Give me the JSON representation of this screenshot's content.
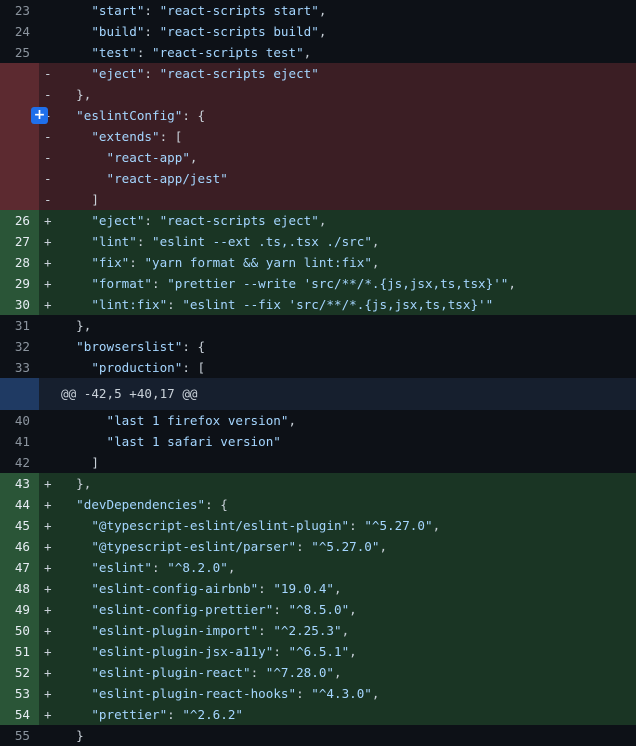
{
  "diff": {
    "lines": [
      {
        "type": "context",
        "num": "23",
        "sign": "",
        "segs": [
          [
            "p",
            "    "
          ],
          [
            "k",
            "\"start\""
          ],
          [
            "p",
            ": "
          ],
          [
            "k",
            "\"react-scripts start\""
          ],
          [
            "p",
            ","
          ]
        ]
      },
      {
        "type": "context",
        "num": "24",
        "sign": "",
        "segs": [
          [
            "p",
            "    "
          ],
          [
            "k",
            "\"build\""
          ],
          [
            "p",
            ": "
          ],
          [
            "k",
            "\"react-scripts build\""
          ],
          [
            "p",
            ","
          ]
        ]
      },
      {
        "type": "context",
        "num": "25",
        "sign": "",
        "segs": [
          [
            "p",
            "    "
          ],
          [
            "k",
            "\"test\""
          ],
          [
            "p",
            ": "
          ],
          [
            "k",
            "\"react-scripts test\""
          ],
          [
            "p",
            ","
          ]
        ]
      },
      {
        "type": "del",
        "num": "",
        "sign": "-",
        "segs": [
          [
            "p",
            "    "
          ],
          [
            "k",
            "\"eject\""
          ],
          [
            "p",
            ": "
          ],
          [
            "k",
            "\"react-scripts eject\""
          ]
        ]
      },
      {
        "type": "del",
        "num": "",
        "sign": "-",
        "segs": [
          [
            "p",
            "  },"
          ]
        ]
      },
      {
        "type": "del",
        "num": "",
        "sign": "-",
        "expand": true,
        "segs": [
          [
            "p",
            "  "
          ],
          [
            "k",
            "\"eslintConfig\""
          ],
          [
            "p",
            ": {"
          ]
        ]
      },
      {
        "type": "del",
        "num": "",
        "sign": "-",
        "segs": [
          [
            "p",
            "    "
          ],
          [
            "k",
            "\"extends\""
          ],
          [
            "p",
            ": ["
          ]
        ]
      },
      {
        "type": "del",
        "num": "",
        "sign": "-",
        "segs": [
          [
            "p",
            "      "
          ],
          [
            "k",
            "\"react-app\""
          ],
          [
            "p",
            ","
          ]
        ]
      },
      {
        "type": "del",
        "num": "",
        "sign": "-",
        "segs": [
          [
            "p",
            "      "
          ],
          [
            "k",
            "\"react-app/jest\""
          ]
        ]
      },
      {
        "type": "del",
        "num": "",
        "sign": "-",
        "segs": [
          [
            "p",
            "    ]"
          ]
        ]
      },
      {
        "type": "add",
        "num": "26",
        "sign": "+",
        "segs": [
          [
            "p",
            "    "
          ],
          [
            "k",
            "\"eject\""
          ],
          [
            "p",
            ": "
          ],
          [
            "k",
            "\"react-scripts eject\""
          ],
          [
            "p",
            ","
          ]
        ]
      },
      {
        "type": "add",
        "num": "27",
        "sign": "+",
        "segs": [
          [
            "p",
            "    "
          ],
          [
            "k",
            "\"lint\""
          ],
          [
            "p",
            ": "
          ],
          [
            "k",
            "\"eslint --ext .ts,.tsx ./src\""
          ],
          [
            "p",
            ","
          ]
        ]
      },
      {
        "type": "add",
        "num": "28",
        "sign": "+",
        "segs": [
          [
            "p",
            "    "
          ],
          [
            "k",
            "\"fix\""
          ],
          [
            "p",
            ": "
          ],
          [
            "k",
            "\"yarn format && yarn lint:fix\""
          ],
          [
            "p",
            ","
          ]
        ]
      },
      {
        "type": "add",
        "num": "29",
        "sign": "+",
        "segs": [
          [
            "p",
            "    "
          ],
          [
            "k",
            "\"format\""
          ],
          [
            "p",
            ": "
          ],
          [
            "k",
            "\"prettier --write 'src/**/*.{js,jsx,ts,tsx}'\""
          ],
          [
            "p",
            ","
          ]
        ]
      },
      {
        "type": "add",
        "num": "30",
        "sign": "+",
        "segs": [
          [
            "p",
            "    "
          ],
          [
            "k",
            "\"lint:fix\""
          ],
          [
            "p",
            ": "
          ],
          [
            "k",
            "\"eslint --fix 'src/**/*.{js,jsx,ts,tsx}'\""
          ]
        ]
      },
      {
        "type": "context",
        "num": "31",
        "sign": "",
        "segs": [
          [
            "p",
            "  },"
          ]
        ]
      },
      {
        "type": "context",
        "num": "32",
        "sign": "",
        "segs": [
          [
            "p",
            "  "
          ],
          [
            "k",
            "\"browserslist\""
          ],
          [
            "p",
            ": {"
          ]
        ]
      },
      {
        "type": "context",
        "num": "33",
        "sign": "",
        "segs": [
          [
            "p",
            "    "
          ],
          [
            "k",
            "\"production\""
          ],
          [
            "p",
            ": ["
          ]
        ]
      },
      {
        "type": "hunk",
        "num": "",
        "sign": "",
        "segs": [
          [
            "p",
            "@@ -42,5 +40,17 @@"
          ]
        ]
      },
      {
        "type": "context",
        "num": "40",
        "sign": "",
        "segs": [
          [
            "p",
            "      "
          ],
          [
            "k",
            "\"last 1 firefox version\""
          ],
          [
            "p",
            ","
          ]
        ]
      },
      {
        "type": "context",
        "num": "41",
        "sign": "",
        "segs": [
          [
            "p",
            "      "
          ],
          [
            "k",
            "\"last 1 safari version\""
          ]
        ]
      },
      {
        "type": "context",
        "num": "42",
        "sign": "",
        "segs": [
          [
            "p",
            "    ]"
          ]
        ]
      },
      {
        "type": "add",
        "num": "43",
        "sign": "+",
        "segs": [
          [
            "p",
            "  },"
          ]
        ]
      },
      {
        "type": "add",
        "num": "44",
        "sign": "+",
        "segs": [
          [
            "p",
            "  "
          ],
          [
            "k",
            "\"devDependencies\""
          ],
          [
            "p",
            ": {"
          ]
        ]
      },
      {
        "type": "add",
        "num": "45",
        "sign": "+",
        "segs": [
          [
            "p",
            "    "
          ],
          [
            "k",
            "\"@typescript-eslint/eslint-plugin\""
          ],
          [
            "p",
            ": "
          ],
          [
            "k",
            "\"^5.27.0\""
          ],
          [
            "p",
            ","
          ]
        ]
      },
      {
        "type": "add",
        "num": "46",
        "sign": "+",
        "segs": [
          [
            "p",
            "    "
          ],
          [
            "k",
            "\"@typescript-eslint/parser\""
          ],
          [
            "p",
            ": "
          ],
          [
            "k",
            "\"^5.27.0\""
          ],
          [
            "p",
            ","
          ]
        ]
      },
      {
        "type": "add",
        "num": "47",
        "sign": "+",
        "segs": [
          [
            "p",
            "    "
          ],
          [
            "k",
            "\"eslint\""
          ],
          [
            "p",
            ": "
          ],
          [
            "k",
            "\"^8.2.0\""
          ],
          [
            "p",
            ","
          ]
        ]
      },
      {
        "type": "add",
        "num": "48",
        "sign": "+",
        "segs": [
          [
            "p",
            "    "
          ],
          [
            "k",
            "\"eslint-config-airbnb\""
          ],
          [
            "p",
            ": "
          ],
          [
            "k",
            "\"19.0.4\""
          ],
          [
            "p",
            ","
          ]
        ]
      },
      {
        "type": "add",
        "num": "49",
        "sign": "+",
        "segs": [
          [
            "p",
            "    "
          ],
          [
            "k",
            "\"eslint-config-prettier\""
          ],
          [
            "p",
            ": "
          ],
          [
            "k",
            "\"^8.5.0\""
          ],
          [
            "p",
            ","
          ]
        ]
      },
      {
        "type": "add",
        "num": "50",
        "sign": "+",
        "segs": [
          [
            "p",
            "    "
          ],
          [
            "k",
            "\"eslint-plugin-import\""
          ],
          [
            "p",
            ": "
          ],
          [
            "k",
            "\"^2.25.3\""
          ],
          [
            "p",
            ","
          ]
        ]
      },
      {
        "type": "add",
        "num": "51",
        "sign": "+",
        "segs": [
          [
            "p",
            "    "
          ],
          [
            "k",
            "\"eslint-plugin-jsx-a11y\""
          ],
          [
            "p",
            ": "
          ],
          [
            "k",
            "\"^6.5.1\""
          ],
          [
            "p",
            ","
          ]
        ]
      },
      {
        "type": "add",
        "num": "52",
        "sign": "+",
        "segs": [
          [
            "p",
            "    "
          ],
          [
            "k",
            "\"eslint-plugin-react\""
          ],
          [
            "p",
            ": "
          ],
          [
            "k",
            "\"^7.28.0\""
          ],
          [
            "p",
            ","
          ]
        ]
      },
      {
        "type": "add",
        "num": "53",
        "sign": "+",
        "segs": [
          [
            "p",
            "    "
          ],
          [
            "k",
            "\"eslint-plugin-react-hooks\""
          ],
          [
            "p",
            ": "
          ],
          [
            "k",
            "\"^4.3.0\""
          ],
          [
            "p",
            ","
          ]
        ]
      },
      {
        "type": "add",
        "num": "54",
        "sign": "+",
        "segs": [
          [
            "p",
            "    "
          ],
          [
            "k",
            "\"prettier\""
          ],
          [
            "p",
            ": "
          ],
          [
            "k",
            "\"^2.6.2\""
          ]
        ]
      },
      {
        "type": "context",
        "num": "55",
        "sign": "",
        "segs": [
          [
            "p",
            "  }"
          ]
        ]
      }
    ],
    "expand_button_label": "+"
  },
  "colors": {
    "background": "#0d1117",
    "deletion": "#3b1e24",
    "addition": "#1a3524",
    "hunk_header": "#161f2e",
    "string": "#a5d6ff",
    "accent": "#1f6feb"
  }
}
